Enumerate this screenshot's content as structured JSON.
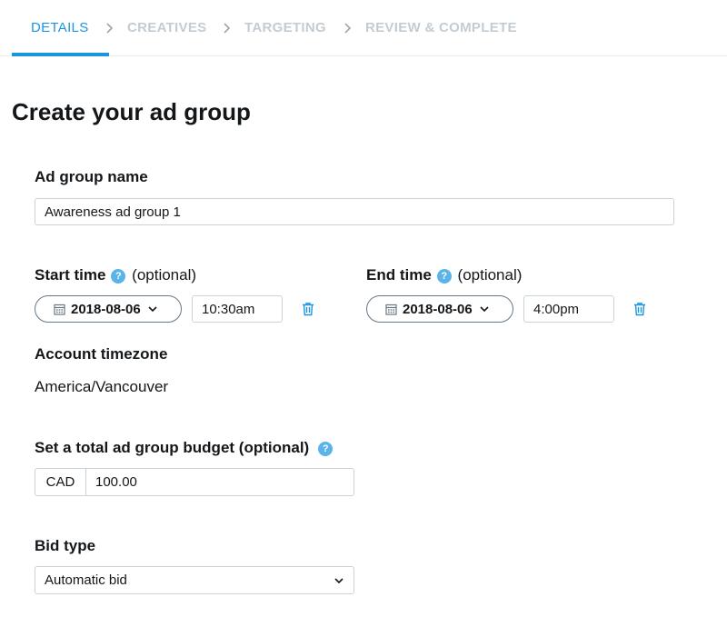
{
  "stepper": {
    "steps": [
      {
        "label": "DETAILS",
        "active": true
      },
      {
        "label": "CREATIVES",
        "active": false
      },
      {
        "label": "TARGETING",
        "active": false
      },
      {
        "label": "REVIEW & COMPLETE",
        "active": false
      }
    ]
  },
  "page_title": "Create your ad group",
  "ad_group_name": {
    "label": "Ad group name",
    "value": "Awareness ad group 1"
  },
  "start_time": {
    "label": "Start time",
    "optional": "(optional)",
    "date": "2018-08-06",
    "time": "10:30am"
  },
  "end_time": {
    "label": "End time",
    "optional": "(optional)",
    "date": "2018-08-06",
    "time": "4:00pm"
  },
  "timezone": {
    "label": "Account timezone",
    "value": "America/Vancouver"
  },
  "budget": {
    "label": "Set a total ad group budget (optional)",
    "currency": "CAD",
    "value": "100.00"
  },
  "bid_type": {
    "label": "Bid type",
    "selected": "Automatic bid"
  },
  "help_glyph": "?",
  "colors": {
    "accent": "#1b95e0",
    "help_icon": "#5ab4ea",
    "inactive_step": "#c3ccd3",
    "border": "#c9d3da"
  }
}
